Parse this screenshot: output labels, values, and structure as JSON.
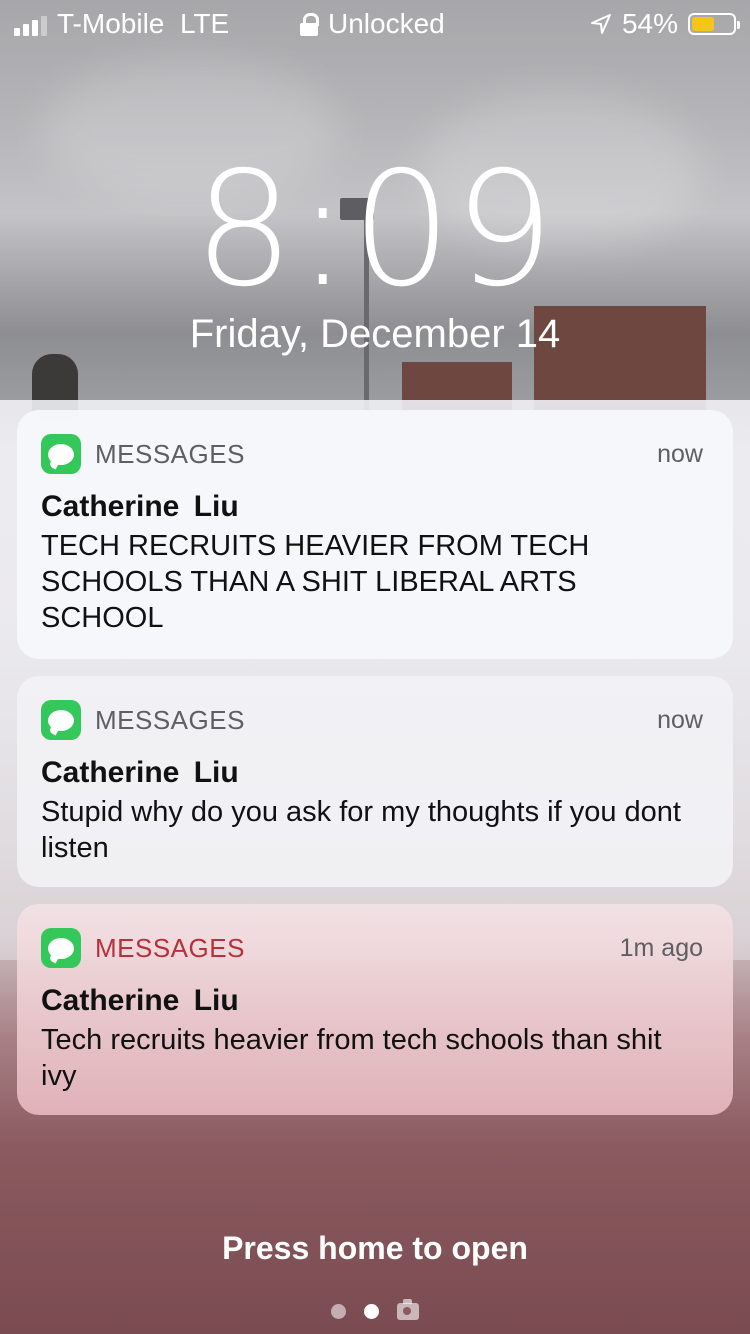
{
  "status_bar": {
    "carrier": "T-Mobile",
    "network": "LTE",
    "lock_label": "Unlocked",
    "battery_percent": "54%",
    "battery_level": 0.54,
    "battery_color": "#f5c518"
  },
  "lock_screen": {
    "time": "8:09",
    "date": "Friday, December 14",
    "press_home": "Press home to open",
    "page_indicator": {
      "pages": 2,
      "active_index": 1,
      "trailing_icon": "camera-icon"
    }
  },
  "notifications": [
    {
      "app": "MESSAGES",
      "time": "now",
      "sender": "Catherine  Liu",
      "body": "TECH RECRUITS HEAVIER FROM TECH SCHOOLS THAN A SHIT LIBERAL ARTS SCHOOL",
      "icon": "messages-icon"
    },
    {
      "app": "MESSAGES",
      "time": "now",
      "sender": "Catherine  Liu",
      "body": "Stupid why do you ask for my thoughts if you dont listen",
      "icon": "messages-icon"
    },
    {
      "app": "MESSAGES",
      "time": "1m ago",
      "sender": "Catherine  Liu",
      "body": "Tech recruits heavier from tech schools than shit ivy",
      "icon": "messages-icon"
    }
  ],
  "colors": {
    "messages_green": "#34c759",
    "text_dark": "#111111"
  }
}
